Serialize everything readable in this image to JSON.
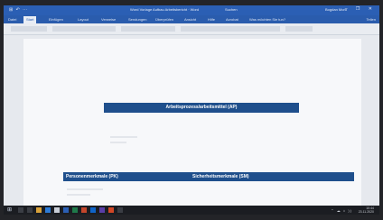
{
  "titlebar": {
    "quick_access": "⊞ ↶ ⋯",
    "doc_title": "Word Vorlage Aufbau Arbeitsbericht · Word",
    "search_label": "Suchen",
    "user": "Bogdan Moro",
    "window_controls": "– ❐ ✕"
  },
  "ribbon": {
    "tabs": [
      "Datei",
      "Start",
      "Einfügen",
      "Layout",
      "Verweise",
      "Sendungen",
      "Überprüfen",
      "Ansicht",
      "Hilfe",
      "Acrobat",
      "Was möchten Sie tun?"
    ],
    "active_tab_index": 1,
    "share": "Teilen"
  },
  "document": {
    "ap_header": "Arbeitsprozess/arbeitsmittel (AP)",
    "left_column_header": "Personenmerkmale (PK)",
    "right_column_header": "Sicherheitsmerkmale (SM)"
  },
  "taskbar": {
    "start_glyph": "⊞",
    "tray_icons": "⌃ ☁ ⌂ ))",
    "time": "10:44",
    "date": "23.11.2020"
  },
  "colors": {
    "titlebar": "#2b5fb4",
    "header_fill": "#1f4f8c",
    "taskbar": "#1b1d22"
  }
}
